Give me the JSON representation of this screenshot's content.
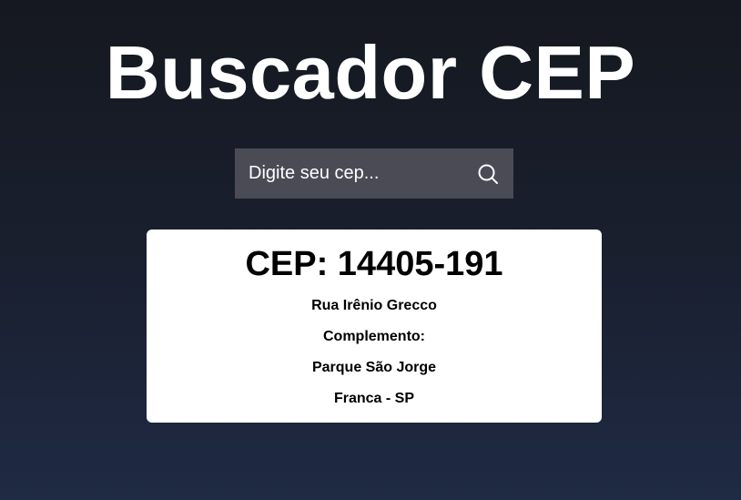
{
  "header": {
    "title": "Buscador CEP"
  },
  "search": {
    "placeholder": "Digite seu cep...",
    "value": "",
    "button_icon": "search-icon"
  },
  "result": {
    "cep_label": "CEP: 14405-191",
    "street": "Rua Irênio Grecco",
    "complement": "Complemento:",
    "neighborhood": "Parque São Jorge",
    "city_state": "Franca - SP"
  },
  "colors": {
    "background_top": "#15181f",
    "background_bottom": "#1f2a44",
    "search_bg": "#4a4b55",
    "card_bg": "#ffffff",
    "title_text": "#ffffff"
  }
}
